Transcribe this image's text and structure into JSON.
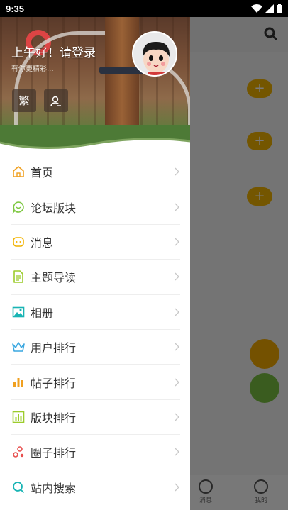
{
  "status_bar": {
    "time": "9:35"
  },
  "drawer": {
    "greeting": "上午好！请登录",
    "subtext": "有你更精彩...",
    "traditional_button": "繁",
    "menu_items": [
      {
        "label": "首页",
        "icon": "home-icon",
        "color": "#f0a020"
      },
      {
        "label": "论坛版块",
        "icon": "chat-bubble-icon",
        "color": "#7cc73f"
      },
      {
        "label": "消息",
        "icon": "message-icon",
        "color": "#f2b300"
      },
      {
        "label": "主题导读",
        "icon": "document-icon",
        "color": "#9ccc2c"
      },
      {
        "label": "相册",
        "icon": "image-icon",
        "color": "#18b4b4"
      },
      {
        "label": "用户排行",
        "icon": "crown-icon",
        "color": "#3aa7e0"
      },
      {
        "label": "帖子排行",
        "icon": "bar-chart-icon",
        "color": "#f0a020"
      },
      {
        "label": "版块排行",
        "icon": "chart-box-icon",
        "color": "#9ccc2c"
      },
      {
        "label": "圈子排行",
        "icon": "circles-icon",
        "color": "#e8504f"
      },
      {
        "label": "站内搜索",
        "icon": "search-icon",
        "color": "#18b4b4"
      }
    ]
  },
  "background": {
    "tabs": [
      "消息",
      "我的"
    ],
    "accent": "#f2b300"
  }
}
